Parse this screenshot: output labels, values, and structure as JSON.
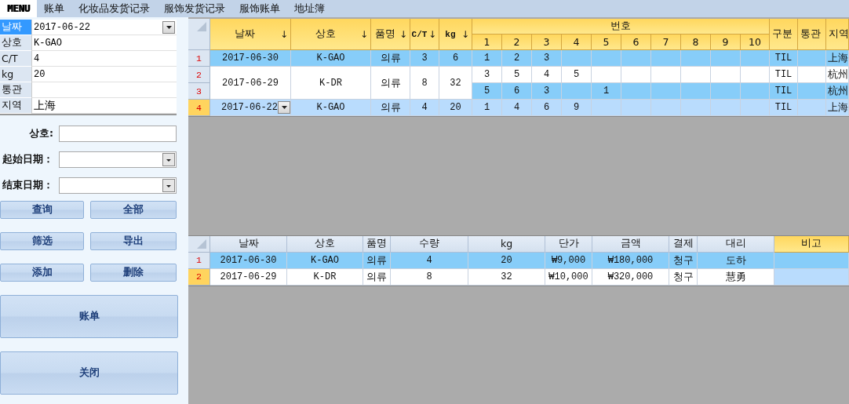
{
  "menu": [
    {
      "label": "MENU",
      "selected": true
    },
    {
      "label": "账单",
      "selected": false
    },
    {
      "label": "化妆品发货记录",
      "selected": false
    },
    {
      "label": "服饰发货记录",
      "selected": false
    },
    {
      "label": "服饰账单",
      "selected": false
    },
    {
      "label": "地址簿",
      "selected": false
    }
  ],
  "properties": [
    {
      "label": "날짜",
      "value": "2017-06-22",
      "selected": true,
      "kind": "dropdown"
    },
    {
      "label": "상호",
      "value": "K-GAO",
      "selected": false,
      "kind": "text"
    },
    {
      "label": "C/T",
      "value": "4",
      "selected": false,
      "kind": "text"
    },
    {
      "label": "kg",
      "value": "20",
      "selected": false,
      "kind": "text"
    },
    {
      "label": "통관",
      "selected": false,
      "kind": "text"
    },
    {
      "label": "지역",
      "value": "上海",
      "selected": false,
      "kind": "text"
    }
  ],
  "filters": [
    {
      "label": "상호:",
      "kind": "text"
    },
    {
      "label": "起始日期：",
      "kind": "dropdown"
    },
    {
      "label": "结束日期：",
      "kind": "dropdown"
    }
  ],
  "buttons": {
    "small": [
      {
        "label": "查询"
      },
      {
        "label": "全部"
      },
      {
        "label": "筛选"
      },
      {
        "label": "导出"
      },
      {
        "label": "添加"
      },
      {
        "label": "删除"
      }
    ],
    "large": [
      {
        "label": "账单"
      },
      {
        "label": "关闭"
      }
    ]
  },
  "top_grid": {
    "columns": [
      {
        "label": "날짜",
        "sort_mark": "↓"
      },
      {
        "label": "상호",
        "sort_mark": "↓"
      },
      {
        "label": "품명",
        "sort_mark": "↓"
      },
      {
        "label": "C/T",
        "sort_mark": "↓"
      },
      {
        "label": "kg",
        "sort_mark": "↓"
      }
    ],
    "number_group": {
      "label": "번호",
      "columns": [
        "1",
        "2",
        "3",
        "4",
        "5",
        "6",
        "7",
        "8",
        "9",
        "10"
      ]
    },
    "trailing_columns": [
      "구분",
      "통관",
      "지역"
    ],
    "records": [
      {
        "date": "2017-06-30",
        "company": "K-GAO",
        "item": "의류",
        "ct": "3",
        "kg": "6",
        "lines": [
          {
            "row_number": "1",
            "selected": true,
            "current": false,
            "numbers": {
              "1": "1",
              "2": "2",
              "3": "3"
            },
            "type": "TIL",
            "region": "上海"
          }
        ]
      },
      {
        "date": "2017-06-29",
        "company": "K-DR",
        "item": "의류",
        "ct": "8",
        "kg": "32",
        "lines": [
          {
            "row_number": "2",
            "selected": false,
            "current": false,
            "numbers": {
              "1": "3",
              "2": "5",
              "3": "4",
              "4": "5"
            },
            "type": "TIL",
            "region": "杭州"
          },
          {
            "row_number": "3",
            "selected": true,
            "current": false,
            "numbers": {
              "1": "5",
              "2": "6",
              "3": "3",
              "5": "1"
            },
            "type": "TIL",
            "region": "杭州"
          }
        ]
      },
      {
        "date": "2017-06-22",
        "company": "K-GAO",
        "item": "의류",
        "ct": "4",
        "kg": "20",
        "lines": [
          {
            "row_number": "4",
            "selected": false,
            "current": true,
            "numbers": {
              "1": "1",
              "2": "4",
              "3": "6",
              "4": "9"
            },
            "type": "TIL",
            "region": "上海"
          }
        ]
      }
    ]
  },
  "bottom_grid": {
    "columns": [
      {
        "label": "날짜",
        "selected": false
      },
      {
        "label": "상호",
        "selected": false
      },
      {
        "label": "품명",
        "selected": false
      },
      {
        "label": "수량",
        "selected": false
      },
      {
        "label": "kg",
        "selected": false
      },
      {
        "label": "단가",
        "selected": false
      },
      {
        "label": "금액",
        "selected": false
      },
      {
        "label": "결제",
        "selected": false
      },
      {
        "label": "대리",
        "selected": false
      },
      {
        "label": "비고",
        "selected": true
      }
    ],
    "rows": [
      {
        "row_number": "1",
        "selected": true,
        "current": false,
        "cells": [
          "2017-06-30",
          "K-GAO",
          "의류",
          "4",
          "20",
          "₩9,000",
          "₩180,000",
          "청구",
          "도하"
        ]
      },
      {
        "row_number": "2",
        "selected": false,
        "current": true,
        "cells": [
          "2017-06-29",
          "K-DR",
          "의류",
          "8",
          "32",
          "₩10,000",
          "₩320,000",
          "청구",
          "慧勇"
        ]
      }
    ]
  }
}
